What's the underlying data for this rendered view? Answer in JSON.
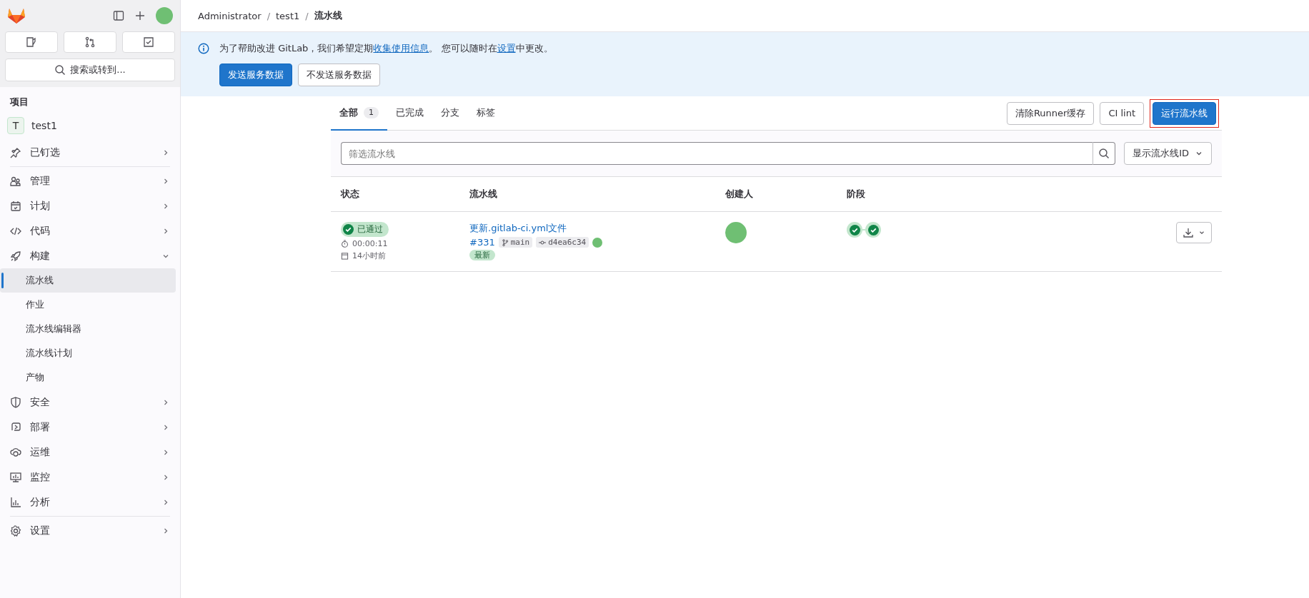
{
  "sidebar": {
    "search_button": "搜索或转到...",
    "section_title": "项目",
    "project": {
      "letter": "T",
      "name": "test1"
    },
    "nav_sections": [
      {
        "items": [
          {
            "label": "已钉选",
            "expanded": false,
            "selected": false
          }
        ]
      },
      {
        "items": [
          {
            "label": "管理",
            "expanded": false,
            "selected": false
          },
          {
            "label": "计划",
            "expanded": false,
            "selected": false
          },
          {
            "label": "代码",
            "expanded": false,
            "selected": false
          },
          {
            "label": "构建",
            "expanded": true,
            "selected": false,
            "children": [
              {
                "label": "流水线",
                "selected": true
              },
              {
                "label": "作业",
                "selected": false
              },
              {
                "label": "流水线编辑器",
                "selected": false
              },
              {
                "label": "流水线计划",
                "selected": false
              },
              {
                "label": "产物",
                "selected": false
              }
            ]
          },
          {
            "label": "安全",
            "expanded": false,
            "selected": false
          },
          {
            "label": "部署",
            "expanded": false,
            "selected": false
          },
          {
            "label": "运维",
            "expanded": false,
            "selected": false
          },
          {
            "label": "监控",
            "expanded": false,
            "selected": false
          },
          {
            "label": "分析",
            "expanded": false,
            "selected": false
          }
        ]
      },
      {
        "items": [
          {
            "label": "设置",
            "expanded": false,
            "selected": false
          }
        ]
      }
    ]
  },
  "breadcrumbs": {
    "separator": "/",
    "items": [
      "Administrator",
      "test1",
      "流水线"
    ]
  },
  "banner": {
    "message": [
      {
        "kind": "text",
        "text": "为了帮助改进 GitLab，我们希望定期"
      },
      {
        "kind": "link",
        "text": "收集使用信息"
      },
      {
        "kind": "text",
        "text": "。 您可以随时在"
      },
      {
        "kind": "link",
        "text": "设置"
      },
      {
        "kind": "text",
        "text": "中更改。"
      }
    ],
    "buttons": [
      {
        "label": "发送服务数据",
        "kind": "primary"
      },
      {
        "label": "不发送服务数据",
        "kind": "default"
      }
    ]
  },
  "tabs": [
    {
      "label": "全部",
      "count": "1",
      "selected": true
    },
    {
      "label": "已完成",
      "selected": false
    },
    {
      "label": "分支",
      "selected": false
    },
    {
      "label": "标签",
      "selected": false
    }
  ],
  "actions": [
    {
      "label": "清除Runner缓存",
      "kind": "default",
      "highlighted": false
    },
    {
      "label": "CI lint",
      "kind": "default",
      "highlighted": false
    },
    {
      "label": "运行流水线",
      "kind": "primary",
      "highlighted": true
    }
  ],
  "filter": {
    "placeholder": "筛选流水线",
    "dropdown": "显示流水线ID"
  },
  "table": {
    "columns": [
      "状态",
      "流水线",
      "创建人",
      "阶段"
    ],
    "rows": [
      {
        "status": "已通过",
        "duration": "00:00:11",
        "finished": "14小时前",
        "title": "更新.gitlab-ci.yml文件",
        "id": "#331",
        "ref": "main",
        "commit": "d4ea6c34",
        "badges": [
          "最新"
        ],
        "stages": [
          {
            "kind": "passed"
          },
          {
            "kind": "passed"
          }
        ]
      }
    ]
  }
}
